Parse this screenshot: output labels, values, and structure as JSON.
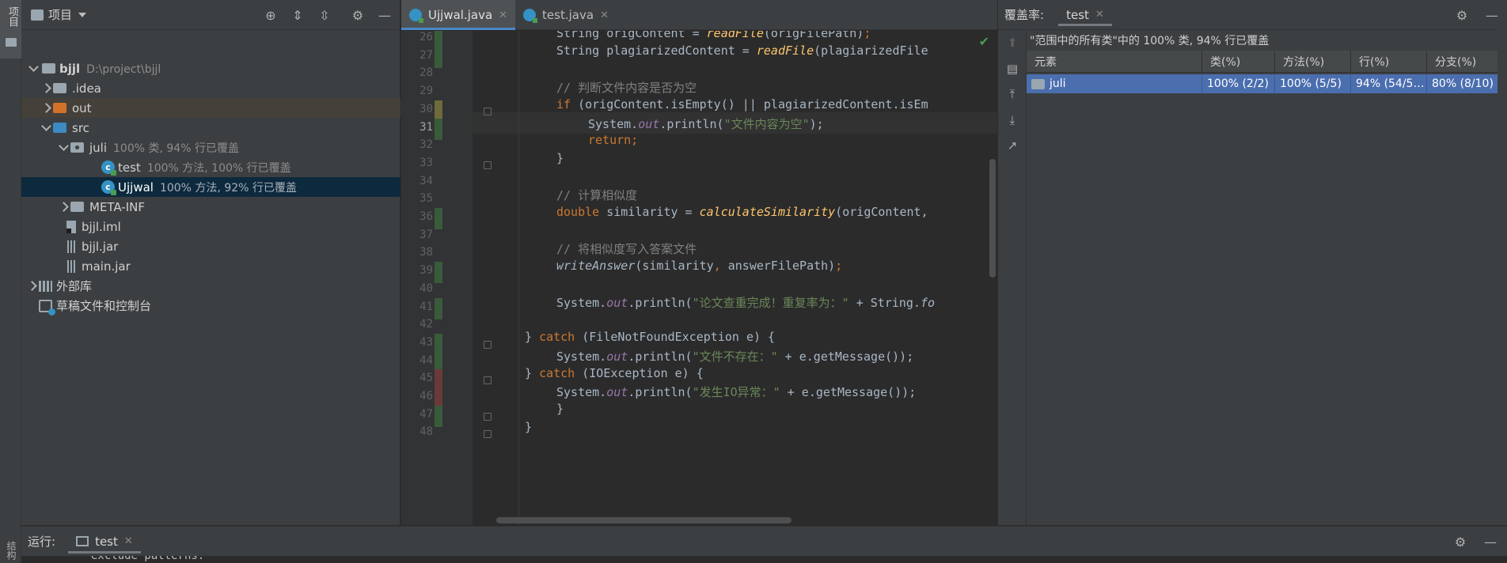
{
  "left_strip": {
    "project_tab": "项目",
    "structure_tab": "结构"
  },
  "project_panel": {
    "title": "项目",
    "tree": [
      {
        "label": "bjjl",
        "hint": "D:\\project\\bjjl"
      },
      {
        "label": ".idea",
        "hint": ""
      },
      {
        "label": "out",
        "hint": ""
      },
      {
        "label": "src",
        "hint": ""
      },
      {
        "label": "juli",
        "hint": "100% 类, 94% 行已覆盖"
      },
      {
        "label": "test",
        "hint": "100% 方法, 100% 行已覆盖"
      },
      {
        "label": "Ujjwal",
        "hint": "100% 方法, 92% 行已覆盖"
      },
      {
        "label": "META-INF",
        "hint": ""
      },
      {
        "label": "bjjl.iml",
        "hint": ""
      },
      {
        "label": "bjjl.jar",
        "hint": ""
      },
      {
        "label": "main.jar",
        "hint": ""
      },
      {
        "label": "外部库",
        "hint": ""
      },
      {
        "label": "草稿文件和控制台",
        "hint": ""
      }
    ]
  },
  "editor": {
    "tabs": [
      {
        "label": "Ujjwal.java"
      },
      {
        "label": "test.java"
      }
    ],
    "line_numbers": [
      "26",
      "27",
      "28",
      "29",
      "30",
      "31",
      "32",
      "33",
      "34",
      "35",
      "36",
      "37",
      "38",
      "39",
      "40",
      "41",
      "42",
      "43",
      "44",
      "45",
      "46",
      "47",
      "48"
    ],
    "code": {
      "l26_a": "String origContent = ",
      "l26_fn": "readFile",
      "l26_b": "(origFilePath)",
      "l26_c": ";",
      "l27_a": "String plagiarizedContent = ",
      "l27_fn": "readFile",
      "l27_b": "(plagiarizedFile",
      "l29": "// 判断文件内容是否为空",
      "l30_kw": "if",
      "l30_b": " (origContent.isEmpty() || plagiarizedContent.isEm",
      "l31_a": "System.",
      "l31_f": "out",
      "l31_b": ".println(",
      "l31_s": "\"文件内容为空\"",
      "l31_c": ");",
      "l32": "return;",
      "l33": "}",
      "l35": "// 计算相似度",
      "l36_kw": "double",
      "l36_a": " similarity = ",
      "l36_fn": "calculateSimilarity",
      "l36_b": "(origContent,",
      "l38": "// 将相似度写入答案文件",
      "l39_it": "writeAnswer",
      "l39_a": "(similarity",
      "l39_c": ",",
      "l39_b": " answerFilePath)",
      "l39_d": ";",
      "l41_a": "System.",
      "l41_f": "out",
      "l41_b": ".println(",
      "l41_s": "\"论文查重完成！重复率为：\"",
      "l41_c": " + String.",
      "l41_fo": "fo",
      "l43_a": "} ",
      "l43_kw": "catch",
      "l43_b": " (FileNotFoundException e) {",
      "l44_a": "System.",
      "l44_f": "out",
      "l44_b": ".println(",
      "l44_s": "\"文件不存在：\"",
      "l44_c": " + e.getMessage());",
      "l45_a": "} ",
      "l45_kw": "catch",
      "l45_b": " (IOException e) {",
      "l46_a": "System.",
      "l46_f": "out",
      "l46_b": ".println(",
      "l46_s": "\"发生IO异常：\"",
      "l46_c": " + e.getMessage());",
      "l47": "}",
      "l48": "}"
    }
  },
  "coverage_panel": {
    "title": "覆盖率:",
    "tab": "test",
    "summary": "\"范围中的所有类\"中的 100% 类, 94% 行已覆盖",
    "columns": [
      "元素",
      "类(%)",
      "方法(%)",
      "行(%)",
      "分支(%)"
    ],
    "rows": [
      {
        "element": "juli",
        "class": "100% (2/2)",
        "method": "100% (5/5)",
        "line": "94% (54/5…",
        "branch": "80% (8/10)"
      }
    ]
  },
  "run_bar": {
    "label": "运行:",
    "tab": "test",
    "console_peek": "exclude patterns:"
  },
  "colors": {
    "accent": "#4a88c7",
    "selection": "#4b6eaf",
    "coverage_green": "#3b5a3b",
    "coverage_yellow": "#6f6a3a",
    "coverage_red": "#6a3a3a"
  }
}
